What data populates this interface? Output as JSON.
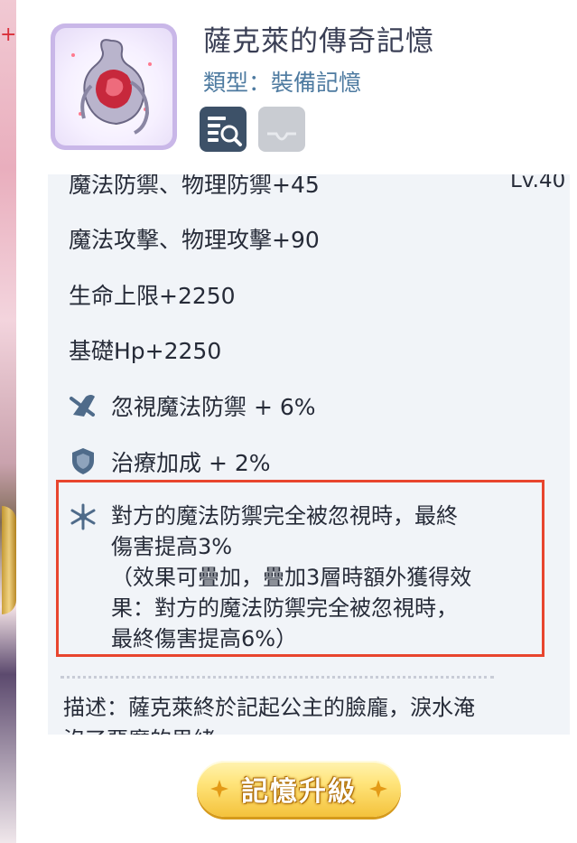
{
  "item": {
    "title": "薩克萊的傳奇記憶",
    "type_label": "類型：裝備記憶"
  },
  "icons": {
    "thumbnail": "memory-item-icon",
    "detail": "magnify-detail-icon",
    "secondary": "tray-icon"
  },
  "stats": {
    "partial_top": "魔法防禦、物理防禦+45",
    "level": "Lv.40",
    "rows": [
      "魔法攻擊、物理攻擊+90",
      "生命上限+2250",
      "基礎Hp+2250"
    ],
    "bonuses": [
      {
        "icon": "ignore-defense-icon",
        "text": "忽視魔法防禦 + 6%"
      },
      {
        "icon": "shield-icon",
        "text": "治療加成 + 2%"
      }
    ],
    "skill": {
      "icon": "snowflake-icon",
      "lines": [
        "對方的魔法防禦完全被忽視時，最終",
        "傷害提高3%",
        "（效果可疊加，疊加3層時額外獲得效",
        "果：對方的魔法防禦完全被忽視時，",
        "最終傷害提高6%）"
      ]
    },
    "description_lines": [
      "描述：薩克萊終於記起公主的臉龐，淚水淹",
      "沒了惡魔的思緒"
    ]
  },
  "actions": {
    "upgrade_label": "記憶升級"
  },
  "colors": {
    "title": "#3a3f55",
    "type_label": "#4d7aa0",
    "highlight_border": "#e8452e",
    "button_gold": "#f4c23c"
  }
}
